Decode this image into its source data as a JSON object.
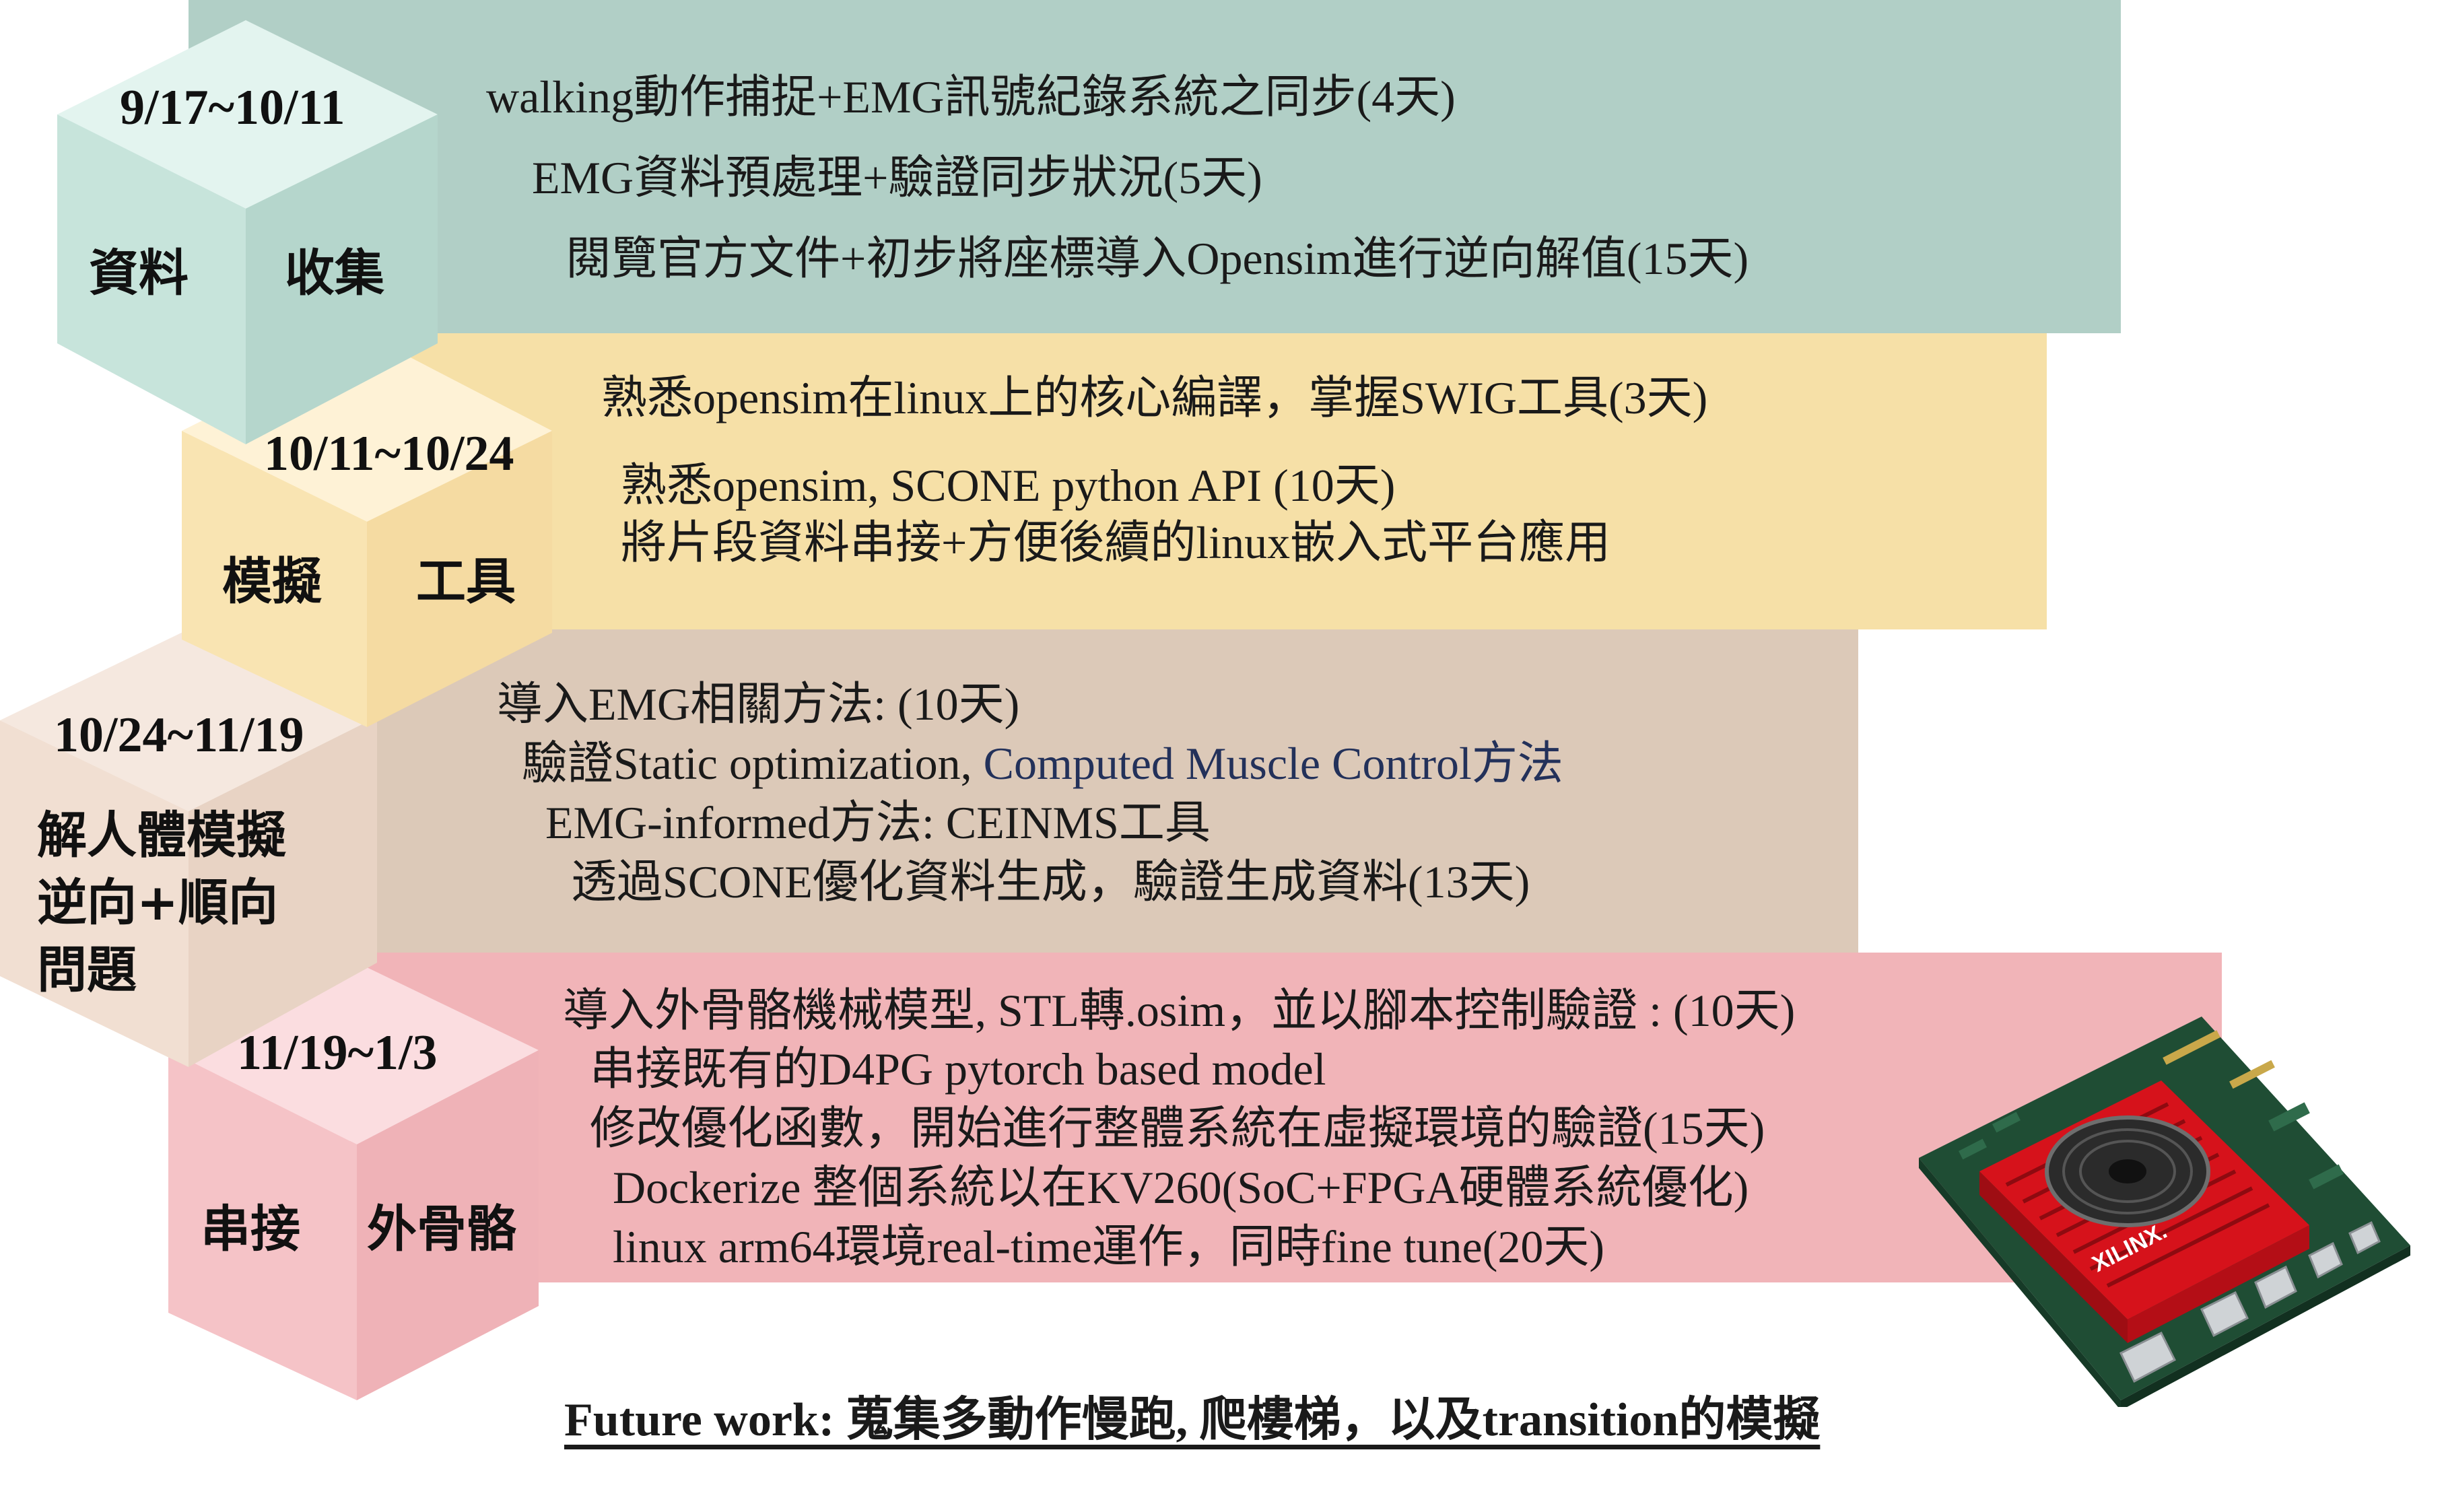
{
  "colors": {
    "phase1_band": "#b1cfc6",
    "phase1_top": "#e3f4ef",
    "phase1_left": "#c7e4db",
    "phase1_right": "#b5d6cc",
    "phase2_band": "#f6e0a7",
    "phase2_top": "#fef2d6",
    "phase2_left": "#f9e4b2",
    "phase2_right": "#f5dba2",
    "phase3_band": "#dcc9b8",
    "phase3_top": "#f5e8df",
    "phase3_left": "#f1dfd2",
    "phase3_right": "#e8d3c4",
    "phase4_band": "#f1b4b8",
    "phase4_top": "#fbdde0",
    "phase4_left": "#f5c3c7",
    "phase4_right": "#efb2b7",
    "highlight_text": "#23315a"
  },
  "phases": [
    {
      "date": "9/17~10/11",
      "label_left": "資料",
      "label_right": "收集",
      "tasks": [
        "walking動作捕捉+EMG訊號紀錄系統之同步(4天)",
        "EMG資料預處理+驗證同步狀況(5天)",
        "閱覽官方文件+初步將座標導入Opensim進行逆向解值(15天)"
      ]
    },
    {
      "date": "10/11~10/24",
      "label_left": "模擬",
      "label_right": "工具",
      "tasks": [
        "熟悉opensim在linux上的核心編譯，掌握SWIG工具(3天)",
        "熟悉opensim, SCONE python API (10天)",
        "將片段資料串接+方便後續的linux嵌入式平台應用"
      ]
    },
    {
      "date": "10/24~11/19",
      "label_lines": [
        "解人體模擬",
        "逆向+順向",
        "問題"
      ],
      "tasks": [
        "導入EMG相關方法: (10天)",
        "驗證Static optimization, ",
        "EMG-informed方法: CEINMS工具",
        "透過SCONE優化資料生成，驗證生成資料(13天)"
      ],
      "task_highlight": "Computed Muscle Control方法"
    },
    {
      "date": "11/19~1/3",
      "label_left": "串接",
      "label_right": "外骨骼",
      "tasks": [
        "導入外骨骼機械模型, STL轉.osim，並以腳本控制驗證 : (10天)",
        "串接既有的D4PG pytorch based model",
        "修改優化函數，開始進行整體系統在虛擬環境的驗證(15天)",
        "Dockerize 整個系統以在KV260(SoC+FPGA硬體系統優化)",
        "linux arm64環境real-time運作，同時fine tune(20天)"
      ]
    }
  ],
  "board_logo": "XILINX.",
  "board_icon": "fpga-board-icon",
  "footer": "Future work: 蒐集多動作慢跑, 爬樓梯，以及transition的模擬"
}
